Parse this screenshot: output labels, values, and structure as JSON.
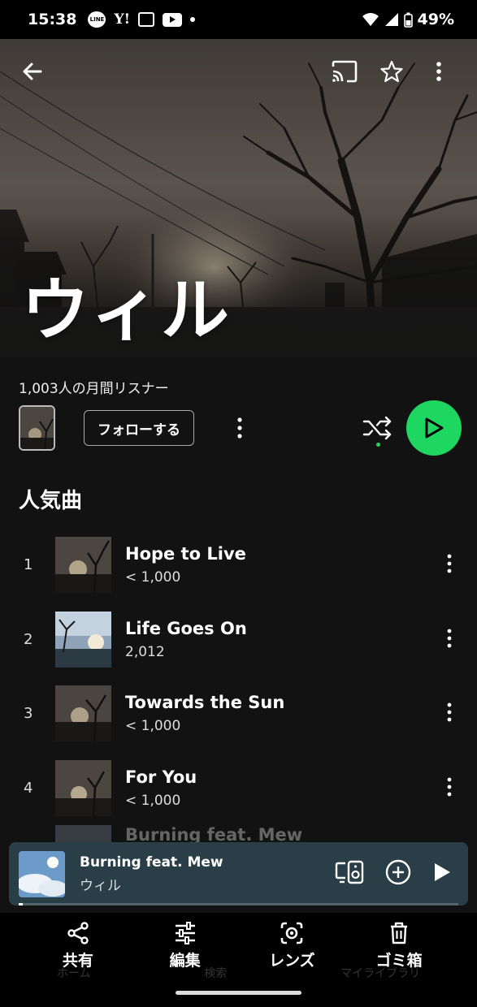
{
  "status_bar": {
    "time": "15:38",
    "notification_icons": [
      "line-icon",
      "yahoo-icon",
      "mail-icon",
      "youtube-icon",
      "dot-icon"
    ],
    "line_label": "LINE",
    "yahoo_label": "Y!",
    "battery": "49%"
  },
  "artist": {
    "name": "ウィル",
    "monthly_listeners": "1,003人の月間リスナー",
    "follow_label": "フォローする"
  },
  "popular": {
    "section_title": "人気曲",
    "tracks": [
      {
        "rank": "1",
        "title": "Hope to Live",
        "plays": "< 1,000"
      },
      {
        "rank": "2",
        "title": "Life Goes On",
        "plays": "2,012"
      },
      {
        "rank": "3",
        "title": "Towards the Sun",
        "plays": "< 1,000"
      },
      {
        "rank": "4",
        "title": "For You",
        "plays": "< 1,000"
      },
      {
        "rank": "",
        "title": "Burning feat. Mew",
        "plays": ""
      }
    ]
  },
  "mini_player": {
    "title": "Burning feat. Mew",
    "artist": "ウィル",
    "progress": 0.01
  },
  "bottom_nav_ghost": [
    "ホーム",
    "検索",
    "マイライブラリ"
  ],
  "toolbar": {
    "share": "共有",
    "edit": "編集",
    "lens": "レンズ",
    "trash": "ゴミ箱"
  },
  "colors": {
    "accent": "#1ed760",
    "background": "#121212",
    "mini_player": "#2a3e47"
  }
}
